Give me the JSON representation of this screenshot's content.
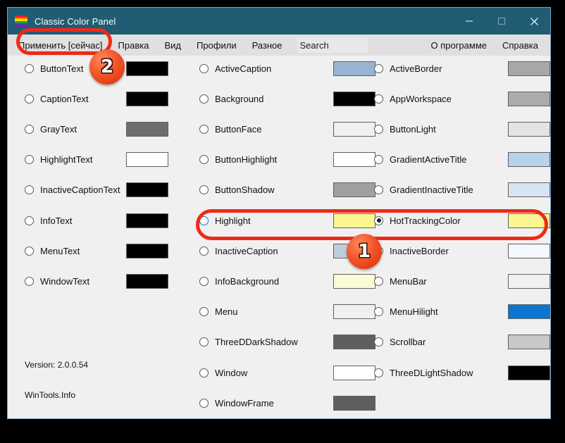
{
  "window": {
    "title": "Classic Color Panel",
    "icon": "rainbow-palette-icon",
    "icon_stripes": [
      "#e52521",
      "#f2820f",
      "#f5e000",
      "#28a128",
      "#1a53c8",
      "#7b1fa2"
    ],
    "titlebar_color": "#205c74",
    "minimize_label": "Minimize",
    "maximize_label": "Maximize",
    "close_label": "Close"
  },
  "menubar": {
    "items": [
      {
        "label": "Применить [сейчас]"
      },
      {
        "label": "Правка"
      },
      {
        "label": "Вид"
      },
      {
        "label": "Профили"
      },
      {
        "label": "Разное"
      }
    ],
    "search": {
      "value": "Search",
      "placeholder": "Search"
    },
    "right_items": [
      {
        "label": "О программе"
      },
      {
        "label": "Справка"
      }
    ]
  },
  "columns": [
    {
      "name": "column-1",
      "rows": [
        {
          "label": "ButtonText",
          "color": "#000000",
          "state": "unchecked"
        },
        {
          "label": "CaptionText",
          "color": "#000000",
          "state": "unchecked"
        },
        {
          "label": "GrayText",
          "color": "#6d6d6d",
          "state": "unchecked"
        },
        {
          "label": "HighlightText",
          "color": "#ffffff",
          "state": "unchecked"
        },
        {
          "label": "InactiveCaptionText",
          "color": "#000000",
          "state": "unchecked"
        },
        {
          "label": "InfoText",
          "color": "#000000",
          "state": "unchecked"
        },
        {
          "label": "MenuText",
          "color": "#000000",
          "state": "unchecked"
        },
        {
          "label": "WindowText",
          "color": "#000000",
          "state": "unchecked"
        }
      ]
    },
    {
      "name": "column-2",
      "rows": [
        {
          "label": "ActiveCaption",
          "color": "#99b4d1",
          "state": "unchecked"
        },
        {
          "label": "Background",
          "color": "#000000",
          "state": "unchecked"
        },
        {
          "label": "ButtonFace",
          "color": "#f0f0f0",
          "state": "unchecked"
        },
        {
          "label": "ButtonHighlight",
          "color": "#ffffff",
          "state": "unchecked"
        },
        {
          "label": "ButtonShadow",
          "color": "#a0a0a0",
          "state": "unchecked"
        },
        {
          "label": "Highlight",
          "color": "#fbf68f",
          "state": "hover"
        },
        {
          "label": "InactiveCaption",
          "color": "#bfcddb",
          "state": "unchecked"
        },
        {
          "label": "InfoBackground",
          "color": "#fbfbd5",
          "state": "unchecked"
        },
        {
          "label": "Menu",
          "color": "#f0f0f0",
          "state": "unchecked"
        },
        {
          "label": "ThreeDDarkShadow",
          "color": "#5f5f5f",
          "state": "unchecked"
        },
        {
          "label": "Window",
          "color": "#ffffff",
          "state": "unchecked"
        },
        {
          "label": "WindowFrame",
          "color": "#5f5f5f",
          "state": "unchecked"
        }
      ]
    },
    {
      "name": "column-3",
      "rows": [
        {
          "label": "ActiveBorder",
          "color": "#a7a7a7",
          "state": "unchecked"
        },
        {
          "label": "AppWorkspace",
          "color": "#ababab",
          "state": "unchecked"
        },
        {
          "label": "ButtonLight",
          "color": "#e3e3e3",
          "state": "unchecked"
        },
        {
          "label": "GradientActiveTitle",
          "color": "#b9d1ea",
          "state": "unchecked"
        },
        {
          "label": "GradientInactiveTitle",
          "color": "#d7e4f2",
          "state": "unchecked"
        },
        {
          "label": "HotTrackingColor",
          "color": "#fbf68f",
          "state": "checked"
        },
        {
          "label": "InactiveBorder",
          "color": "#f4f7fc",
          "state": "unchecked"
        },
        {
          "label": "MenuBar",
          "color": "#f0f0f0",
          "state": "unchecked"
        },
        {
          "label": "MenuHilight",
          "color": "#0b76d0",
          "state": "unchecked"
        },
        {
          "label": "Scrollbar",
          "color": "#c8c8c8",
          "state": "unchecked"
        },
        {
          "label": "ThreeDLightShadow",
          "color": "#000000",
          "state": "unchecked"
        }
      ]
    }
  ],
  "footer": {
    "version": "Version: 2.0.0.54",
    "site": "WinTools.Info"
  },
  "annotations": {
    "accent_color": "#ee2a18",
    "badge_1": "1",
    "badge_2": "2"
  }
}
